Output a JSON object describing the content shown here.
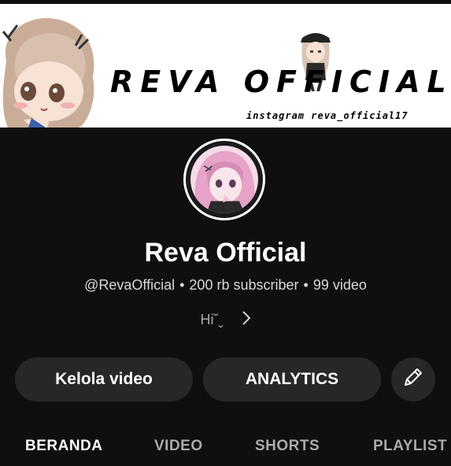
{
  "banner": {
    "title": "REVA OFFICIAL",
    "subtitle": "instagram reva_official17"
  },
  "channel": {
    "name": "Reva Official",
    "handle": "@RevaOfficial",
    "subscribers": "200 rb subscriber",
    "videos": "99 video",
    "separator": "•",
    "description": "Hi˘ˬ"
  },
  "actions": {
    "manage_label": "Kelola video",
    "analytics_label": "ANALYTICS",
    "edit_icon": "pencil-icon"
  },
  "tabs": [
    {
      "label": "BERANDA",
      "active": true
    },
    {
      "label": "VIDEO",
      "active": false
    },
    {
      "label": "SHORTS",
      "active": false
    },
    {
      "label": "PLAYLIST",
      "active": false
    }
  ],
  "colors": {
    "background": "#0f0f0f",
    "button": "#272727",
    "secondary_text": "#aaaaaa",
    "avatar_hair": "#e7a3c8"
  }
}
